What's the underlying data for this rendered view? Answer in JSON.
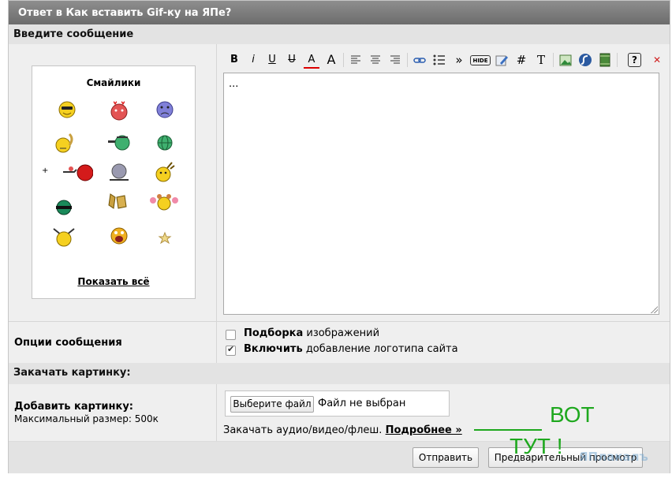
{
  "title": "Ответ в Как вставить Gif-ку на ЯПе?",
  "sections": {
    "message": "Введите сообщение",
    "upload": "Закачать картинку:"
  },
  "smileys": {
    "title": "Смайлики",
    "plus": "+",
    "show_all": "Показать всё",
    "items": [
      "cool-smiley-icon",
      "love-smiley-icon",
      "sad-smiley-icon",
      "annoyed-smiley-icon",
      "sick-smiley-icon",
      "globe-smiley-icon",
      "shooter-smiley-icon",
      "hiding-smiley-icon",
      "dancing-smiley-icon",
      "ninja-smiley-icon",
      "clapping-hands-icon",
      "cheerleader-smiley-icon",
      "hanging-smiley-icon",
      "laughing-smiley-icon",
      "small-star-smiley-icon"
    ]
  },
  "toolbar": {
    "bold": "B",
    "italic": "i",
    "underline": "U",
    "strike": "U",
    "color": "A",
    "size": "A",
    "quote": "»",
    "hide": "HIDE",
    "hash": "#",
    "tex": "T",
    "help": "?",
    "close": "✕"
  },
  "editor": {
    "value": "..."
  },
  "options": {
    "label": "Опции сообщения",
    "selection_bold": "Подборка",
    "selection_rest": " изображений",
    "logo_bold": "Включить",
    "logo_rest": " добавление логотипа сайта"
  },
  "add_image": {
    "title": "Добавить картинку:",
    "max_size": "Максимальный размер: 500к",
    "choose_file": "Выберите файл",
    "no_file": "Файл не выбран",
    "media_text": "Закачать аудио/видео/флеш.",
    "more_link": "Подробнее »"
  },
  "buttons": {
    "submit": "Отправить",
    "preview": "Предварительный просмотр"
  },
  "annotation": {
    "line1": "ВОТ",
    "line2": "ТУТ !"
  },
  "watermark": "ЯПлакалъ",
  "colors": {
    "titlebar": "#7b7b7b",
    "section": "#e3e3e3",
    "annotation": "#1ea81e"
  }
}
